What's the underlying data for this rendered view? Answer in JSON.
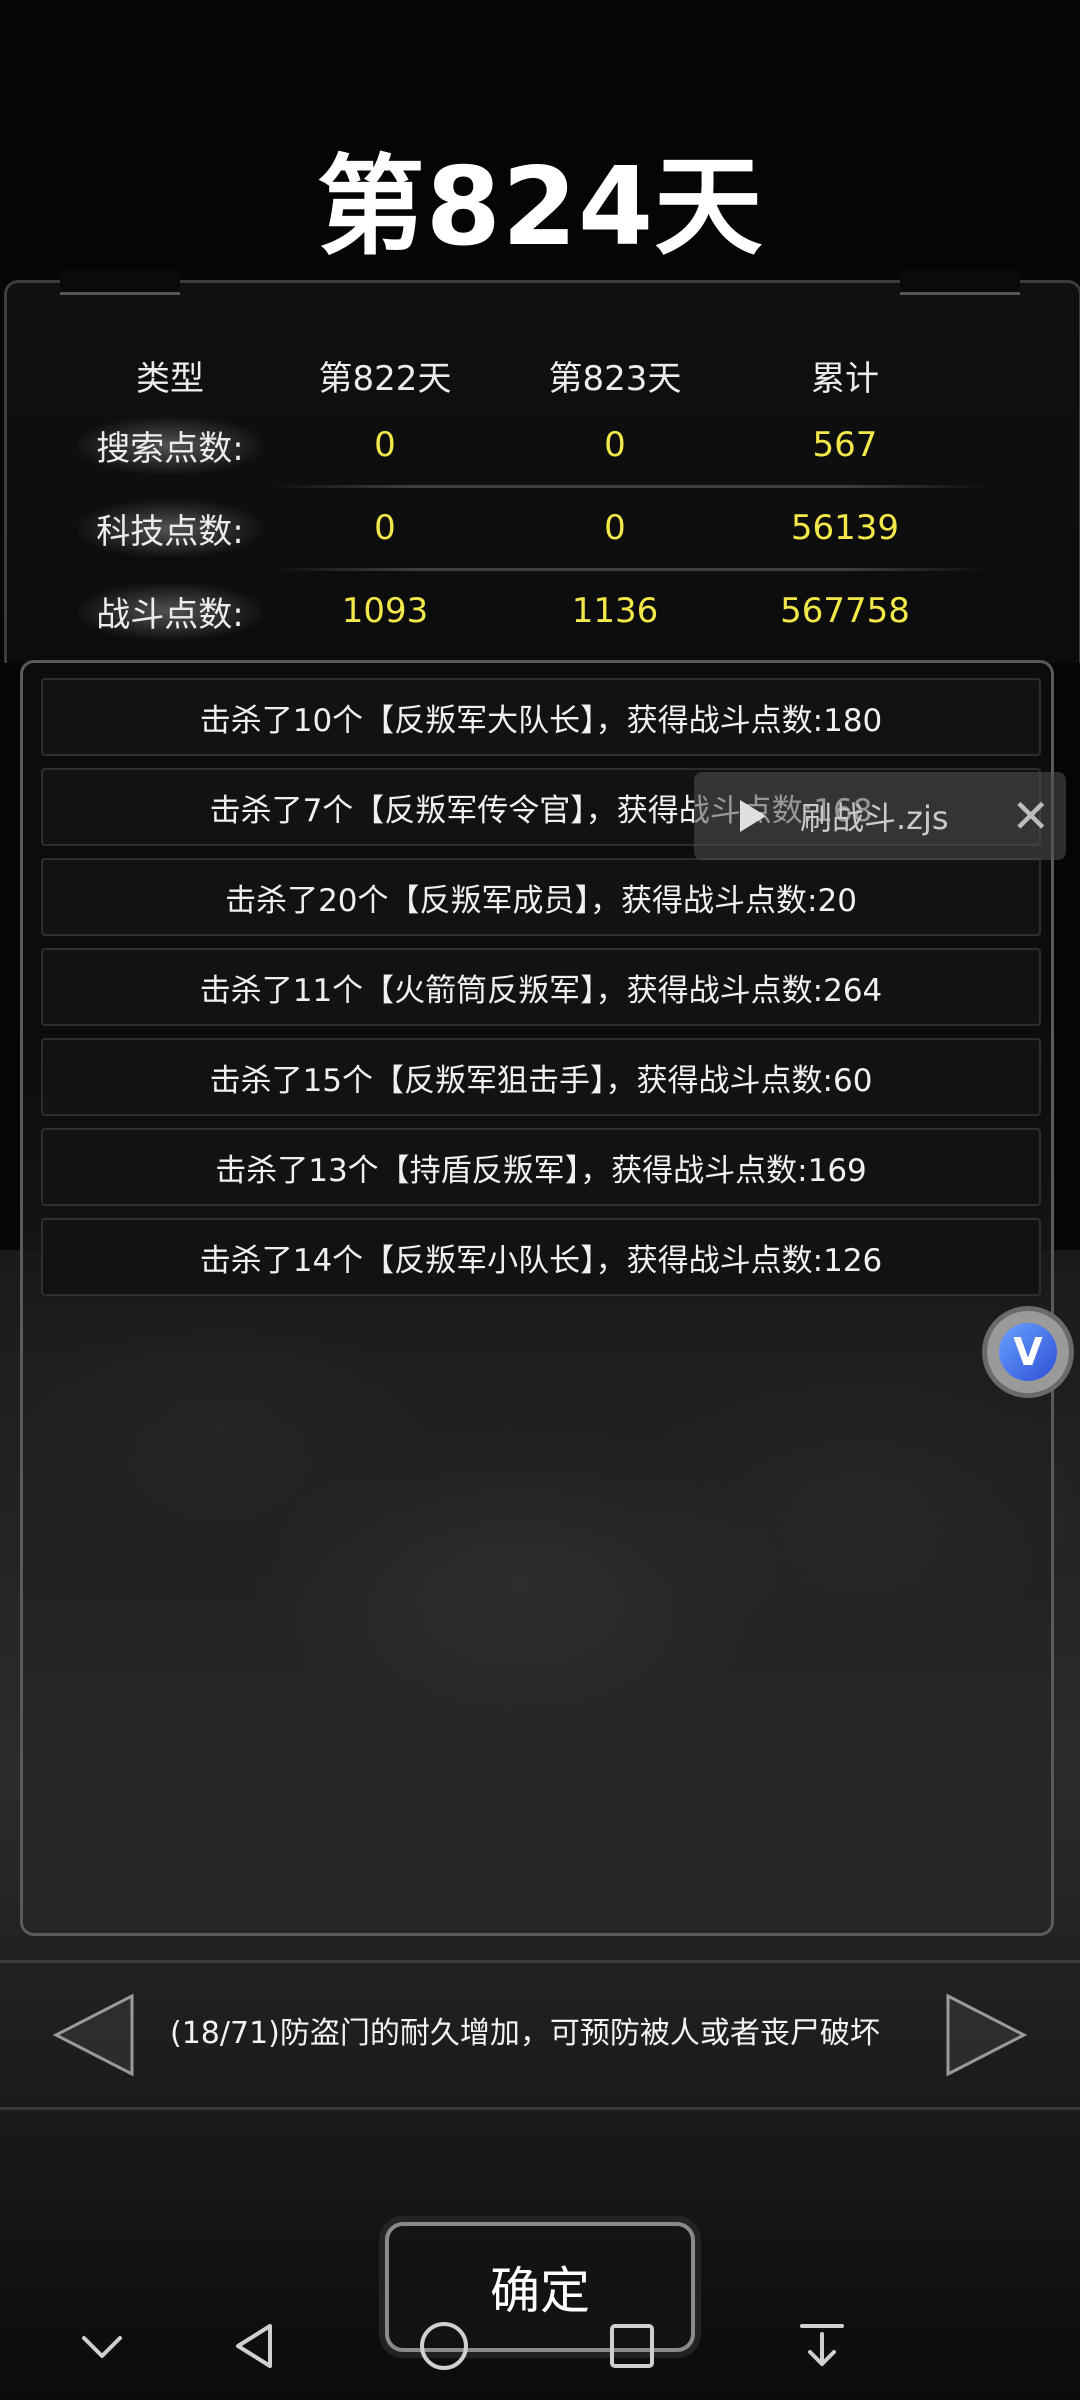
{
  "day_title": "第824天",
  "stats": {
    "headers": [
      "类型",
      "第822天",
      "第823天",
      "累计"
    ],
    "rows": [
      {
        "label": "搜索点数:",
        "day822": "0",
        "day823": "0",
        "total": "567"
      },
      {
        "label": "科技点数:",
        "day822": "0",
        "day823": "0",
        "total": "56139"
      },
      {
        "label": "战斗点数:",
        "day822": "1093",
        "day823": "1136",
        "total": "567758"
      }
    ]
  },
  "battle_log": [
    "击杀了10个【反叛军大队长】，获得战斗点数:180",
    "击杀了7个【反叛军传令官】，获得战斗点数:168",
    "击杀了20个【反叛军成员】，获得战斗点数:20",
    "击杀了11个【火箭筒反叛军】，获得战斗点数:264",
    "击杀了15个【反叛军狙击手】，获得战斗点数:60",
    "击杀了13个【持盾反叛军】，获得战斗点数:169",
    "击杀了14个【反叛军小队长】，获得战斗点数:126"
  ],
  "floating_script": {
    "label": "刷战斗.zjs",
    "icons": [
      "play-icon",
      "close-icon"
    ]
  },
  "side_bubble": {
    "glyph": "V"
  },
  "tip": {
    "text": "(18/71)防盗门的耐久增加，可预防被人或者丧尸破坏",
    "icons": [
      "arrow-left-icon",
      "arrow-right-icon"
    ]
  },
  "confirm_label": "确定",
  "navbar_icons": [
    "collapse-icon",
    "back-icon",
    "home-icon",
    "recents-icon",
    "download-icon"
  ],
  "colors": {
    "highlight_value": "#f2e84a",
    "background": "#050505"
  }
}
